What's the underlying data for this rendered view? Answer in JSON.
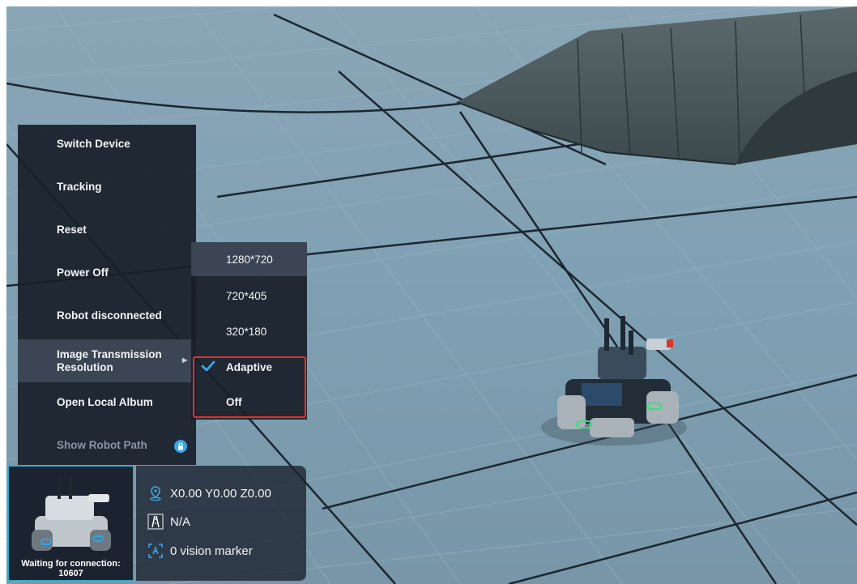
{
  "menu": {
    "items": [
      {
        "label": "Switch Device"
      },
      {
        "label": "Tracking"
      },
      {
        "label": "Reset"
      },
      {
        "label": "Power Off"
      },
      {
        "label": "Robot disconnected"
      },
      {
        "label": "Image Transmission Resolution",
        "line1": "Image Transmission",
        "line2": "Resolution",
        "has_submenu": true
      },
      {
        "label": "Open Local Album"
      },
      {
        "label": "Show Robot Path",
        "disabled": true,
        "icon": "lock-icon"
      }
    ]
  },
  "submenu": {
    "items": [
      {
        "label": "1280*720"
      },
      {
        "label": "720*405"
      },
      {
        "label": "320*180"
      },
      {
        "label": "Adaptive",
        "checked": true
      },
      {
        "label": "Off"
      }
    ],
    "highlight_color": "#e0332e"
  },
  "status": {
    "connection_text": "Waiting for connection:",
    "connection_code": "10607",
    "position": "X0.00 Y0.00 Z0.00",
    "road": "N/A",
    "vision": "0 vision marker"
  },
  "colors": {
    "accent": "#39a7e6",
    "panel_bg": "#181e28",
    "floor": "#7fa3b5"
  }
}
